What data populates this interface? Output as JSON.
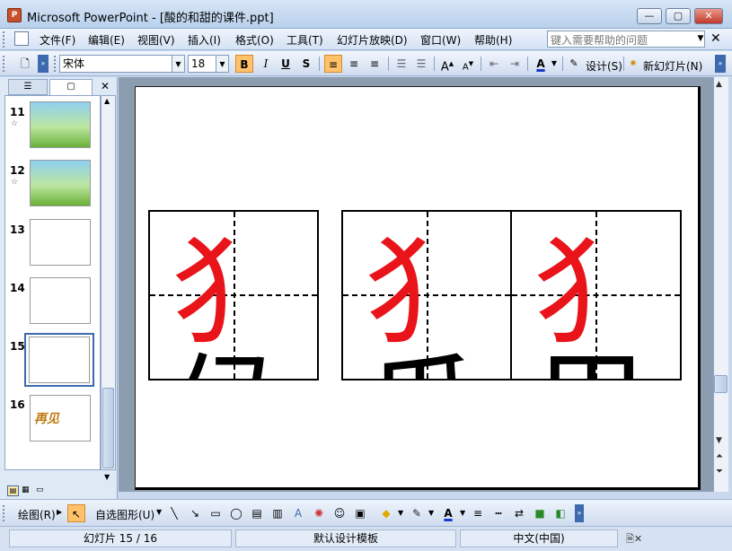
{
  "window": {
    "app_icon_text": "P",
    "title": "Microsoft PowerPoint - [酸的和甜的课件.ppt]"
  },
  "menubar": {
    "items": [
      "文件(F)",
      "编辑(E)",
      "视图(V)",
      "插入(I)",
      "格式(O)",
      "工具(T)",
      "幻灯片放映(D)",
      "窗口(W)",
      "帮助(H)"
    ],
    "help_placeholder": "键入需要帮助的问题"
  },
  "toolbar": {
    "font_name": "宋体",
    "font_size": "18",
    "bold": "B",
    "italic": "I",
    "underline": "U",
    "shadow": "S",
    "design_label": "设计(S)",
    "new_slide_label": "新幻灯片(N)"
  },
  "slides_pane": {
    "slides": [
      {
        "number": "11",
        "star": "☆"
      },
      {
        "number": "12",
        "star": "☆"
      },
      {
        "number": "13",
        "star": ""
      },
      {
        "number": "14",
        "star": ""
      },
      {
        "number": "15",
        "star": ""
      },
      {
        "number": "16",
        "star": ""
      }
    ],
    "selected": "15",
    "thumb16_text": "再见"
  },
  "slide": {
    "characters": [
      {
        "radical": "犭",
        "rest": "侯"
      },
      {
        "radical": "犭",
        "rest": "瓜"
      },
      {
        "radical": "犭",
        "rest": "里"
      }
    ],
    "radical_color": "#e8141a"
  },
  "drawing_toolbar": {
    "draw_label": "绘图(R)",
    "autoshapes_label": "自选图形(U)"
  },
  "statusbar": {
    "slide_info": "幻灯片 15 / 16",
    "template": "默认设计模板",
    "language": "中文(中国)"
  }
}
